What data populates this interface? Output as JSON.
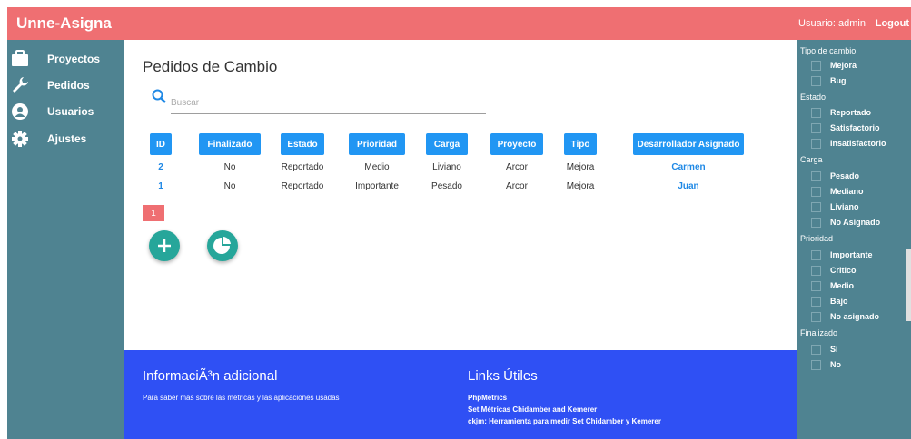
{
  "topbar": {
    "brand": "Unne-Asigna",
    "user": "Usuario: admin",
    "logout": "Logout",
    "color": "#ef6f72"
  },
  "sidebar": {
    "items": [
      {
        "label": "Proyectos",
        "icon": "briefcase-icon"
      },
      {
        "label": "Pedidos",
        "icon": "wrench-icon"
      },
      {
        "label": "Usuarios",
        "icon": "user-icon"
      },
      {
        "label": "Ajustes",
        "icon": "gear-icon"
      }
    ],
    "color": "#4f8391"
  },
  "main": {
    "title": "Pedidos de Cambio",
    "search": {
      "placeholder": "Buscar",
      "value": ""
    },
    "table": {
      "headers": [
        "ID",
        "Finalizado",
        "Estado",
        "Prioridad",
        "Carga",
        "Proyecto",
        "Tipo",
        "Desarrollador Asignado"
      ],
      "rows": [
        [
          "2",
          "No",
          "Reportado",
          "Medio",
          "Liviano",
          "Arcor",
          "Mejora",
          "Carmen"
        ],
        [
          "1",
          "No",
          "Reportado",
          "Importante",
          "Pesado",
          "Arcor",
          "Mejora",
          "Juan"
        ]
      ]
    },
    "pagination": {
      "current": "1"
    }
  },
  "footer": {
    "info_title": "InformaciÃ³n adicional",
    "info_text": "Para saber más sobre las métricas y las aplicaciones usadas",
    "links_title": "Links Útiles",
    "links": [
      "PhpMetrics",
      "Set Métricas Chidamber and Kemerer",
      "ckjm: Herramienta para medir Set Chidamber y Kemerer"
    ],
    "color": "#2f50f4"
  },
  "filters": {
    "groups": [
      {
        "title": "Tipo de cambio",
        "options": [
          "Mejora",
          "Bug"
        ]
      },
      {
        "title": "Estado",
        "options": [
          "Reportado",
          "Satisfactorio",
          "Insatisfactorio"
        ]
      },
      {
        "title": "Carga",
        "options": [
          "Pesado",
          "Mediano",
          "Liviano",
          "No Asignado"
        ]
      },
      {
        "title": "Prioridad",
        "options": [
          "Importante",
          "Critico",
          "Medio",
          "Bajo",
          "No asignado"
        ]
      },
      {
        "title": "Finalizado",
        "options": [
          "Si",
          "No"
        ]
      }
    ]
  }
}
